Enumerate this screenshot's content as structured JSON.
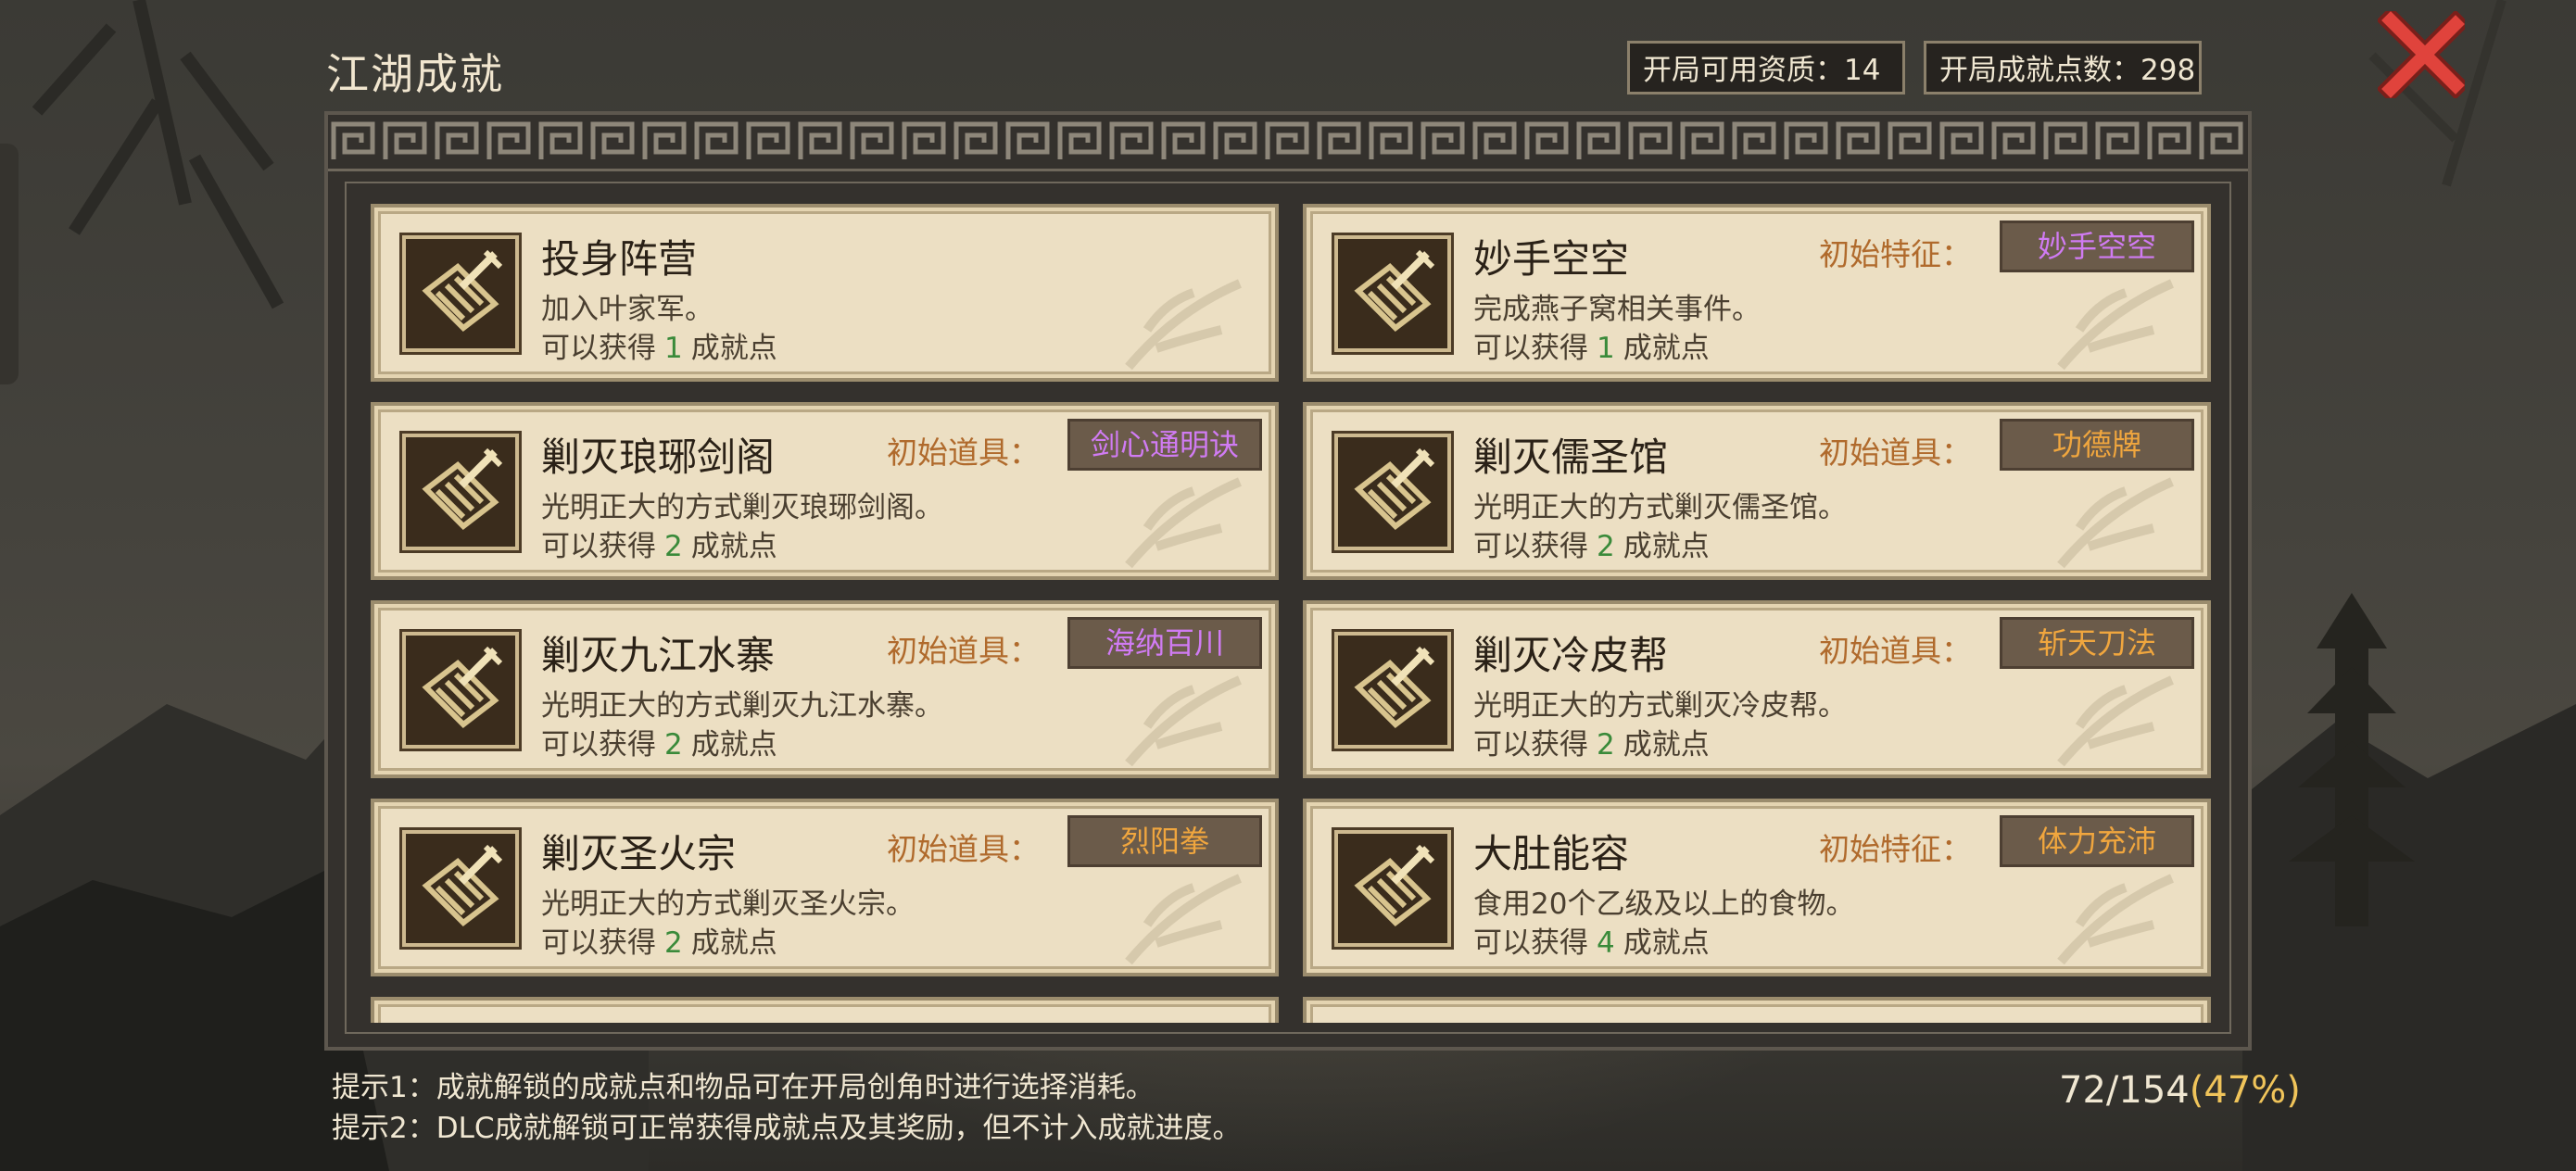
{
  "header": {
    "title": "江湖成就",
    "available_points_label": "开局可用资质：",
    "available_points": "14",
    "achievement_points_label": "开局成就点数：",
    "achievement_points": "298"
  },
  "reward_prefix": "可以获得",
  "reward_suffix": "成就点",
  "achievements": [
    {
      "title": "投身阵营",
      "desc": "加入叶家军。",
      "points": "1",
      "tag_label": "",
      "tag": "",
      "tag_color": ""
    },
    {
      "title": "妙手空空",
      "desc": "完成燕子窝相关事件。",
      "points": "1",
      "tag_label": "初始特征：",
      "tag": "妙手空空",
      "tag_color": "purple"
    },
    {
      "title": "剿灭琅琊剑阁",
      "desc": "光明正大的方式剿灭琅琊剑阁。",
      "points": "2",
      "tag_label": "初始道具：",
      "tag": "剑心通明诀",
      "tag_color": "purple"
    },
    {
      "title": "剿灭儒圣馆",
      "desc": "光明正大的方式剿灭儒圣馆。",
      "points": "2",
      "tag_label": "初始道具：",
      "tag": "功德牌",
      "tag_color": "orange"
    },
    {
      "title": "剿灭九江水寨",
      "desc": "光明正大的方式剿灭九江水寨。",
      "points": "2",
      "tag_label": "初始道具：",
      "tag": "海纳百川",
      "tag_color": "purple"
    },
    {
      "title": "剿灭冷皮帮",
      "desc": "光明正大的方式剿灭冷皮帮。",
      "points": "2",
      "tag_label": "初始道具：",
      "tag": "斩天刀法",
      "tag_color": "orange"
    },
    {
      "title": "剿灭圣火宗",
      "desc": "光明正大的方式剿灭圣火宗。",
      "points": "2",
      "tag_label": "初始道具：",
      "tag": "烈阳拳",
      "tag_color": "orange"
    },
    {
      "title": "大肚能容",
      "desc": "食用20个乙级及以上的食物。",
      "points": "4",
      "tag_label": "初始特征：",
      "tag": "体力充沛",
      "tag_color": "orange"
    }
  ],
  "hints": [
    "提示1：成就解锁的成就点和物品可在开局创角时进行选择消耗。",
    "提示2：DLC成就解锁可正常获得成就点及其奖励，但不计入成就进度。"
  ],
  "progress": {
    "count": "72/154",
    "percent": "(47%)"
  },
  "colors": {
    "purple_tag": "#d07bf3",
    "orange_tag": "#f0a63e",
    "reward_points": "#3a8a3a",
    "tag_label": "#b06a2c",
    "close_icon": "#e0433c",
    "progress_percent": "#f0c45a"
  },
  "icons": {
    "close": "close-x-icon",
    "achievement": "scroll-sword-icon",
    "card_decoration": "bamboo-leaf-icon"
  }
}
